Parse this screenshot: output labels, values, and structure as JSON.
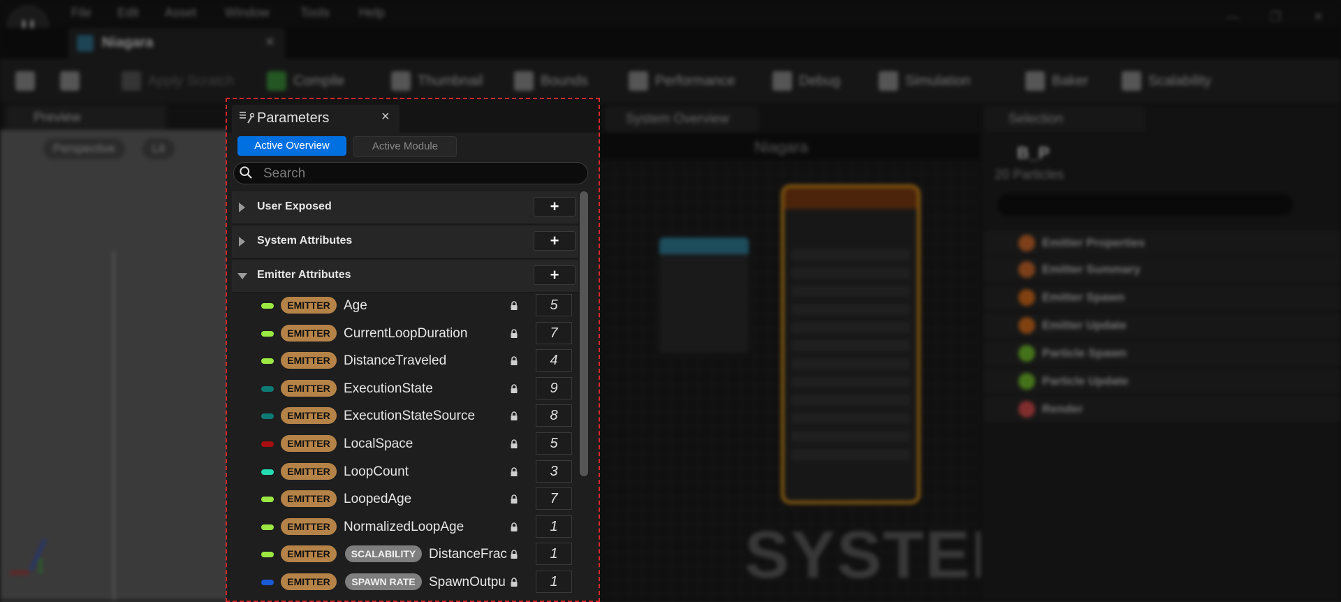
{
  "menu": [
    "File",
    "Edit",
    "Asset",
    "Window",
    "Tools",
    "Help"
  ],
  "document_tab": "Niagara",
  "toolbar": [
    "Apply Scratch",
    "Compile",
    "Thumbnail",
    "Bounds",
    "Performance",
    "Debug",
    "Simulation",
    "Baker",
    "Scalability"
  ],
  "preview": {
    "tab": "Preview",
    "view_mode": "Perspective",
    "lit_mode": "Lit"
  },
  "graph": {
    "tab": "System Overview",
    "title": "Niagara",
    "watermark": "SYSTEM"
  },
  "selection": {
    "tab": "Selection",
    "emitter_name": "B_P",
    "particles": "20 Particles",
    "rows": [
      {
        "label": "Emitter Properties",
        "color": "#c8672a"
      },
      {
        "label": "Emitter Summary",
        "color": "#c8672a"
      },
      {
        "label": "Emitter Spawn",
        "color": "#d06a1c"
      },
      {
        "label": "Emitter Update",
        "color": "#d06a1c"
      },
      {
        "label": "Particle Spawn",
        "color": "#6fb82a"
      },
      {
        "label": "Particle Update",
        "color": "#6fb82a"
      },
      {
        "label": "Render",
        "color": "#d04a4a"
      }
    ]
  },
  "parameters": {
    "title": "Parameters",
    "close": "×",
    "tabs": {
      "active": "Active Overview",
      "module": "Active Module"
    },
    "search_placeholder": "Search",
    "add": "+",
    "categories": {
      "user": "User Exposed",
      "system": "System Attributes",
      "emitter": "Emitter Attributes"
    },
    "rows": [
      {
        "namespace": "EMITTER",
        "sub": "",
        "name": "Age",
        "count": "5",
        "color": "#9be843"
      },
      {
        "namespace": "EMITTER",
        "sub": "",
        "name": "CurrentLoopDuration",
        "count": "7",
        "color": "#9be843"
      },
      {
        "namespace": "EMITTER",
        "sub": "",
        "name": "DistanceTraveled",
        "count": "4",
        "color": "#9be843"
      },
      {
        "namespace": "EMITTER",
        "sub": "",
        "name": "ExecutionState",
        "count": "9",
        "color": "#0d7a74"
      },
      {
        "namespace": "EMITTER",
        "sub": "",
        "name": "ExecutionStateSource",
        "count": "8",
        "color": "#0d7a74"
      },
      {
        "namespace": "EMITTER",
        "sub": "",
        "name": "LocalSpace",
        "count": "5",
        "color": "#a50f0f"
      },
      {
        "namespace": "EMITTER",
        "sub": "",
        "name": "LoopCount",
        "count": "3",
        "color": "#23dcb0"
      },
      {
        "namespace": "EMITTER",
        "sub": "",
        "name": "LoopedAge",
        "count": "7",
        "color": "#9be843"
      },
      {
        "namespace": "EMITTER",
        "sub": "",
        "name": "NormalizedLoopAge",
        "count": "1",
        "color": "#9be843"
      },
      {
        "namespace": "EMITTER",
        "sub": "SCALABILITY",
        "name": "DistanceFrac",
        "count": "1",
        "color": "#9be843"
      },
      {
        "namespace": "EMITTER",
        "sub": "SPAWN RATE",
        "name": "SpawnOutpu",
        "count": "1",
        "color": "#1a5ad6"
      }
    ]
  }
}
